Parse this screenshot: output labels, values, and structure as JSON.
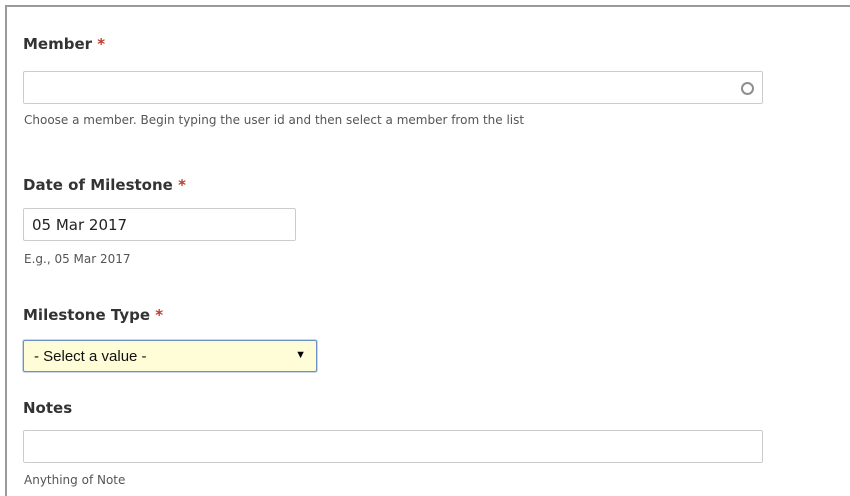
{
  "form": {
    "member": {
      "label": "Member",
      "required_mark": "*",
      "value": "",
      "description": "Choose a member. Begin typing the user id and then select a member from the list",
      "icon": "autocomplete-throbber-icon"
    },
    "date_of_milestone": {
      "label": "Date of Milestone",
      "required_mark": "*",
      "value": "05 Mar 2017",
      "description": "E.g., 05 Mar 2017"
    },
    "milestone_type": {
      "label": "Milestone Type",
      "required_mark": "*",
      "selected_value": "- Select a value -",
      "arrow": "▼",
      "icon": "dropdown-arrow-icon"
    },
    "notes": {
      "label": "Notes",
      "value": "",
      "description": "Anything of Note"
    }
  },
  "colors": {
    "required_mark": "#c0392b",
    "select_background": "#fffcd8",
    "select_border": "#6a93c4",
    "input_border": "#cccccc"
  }
}
